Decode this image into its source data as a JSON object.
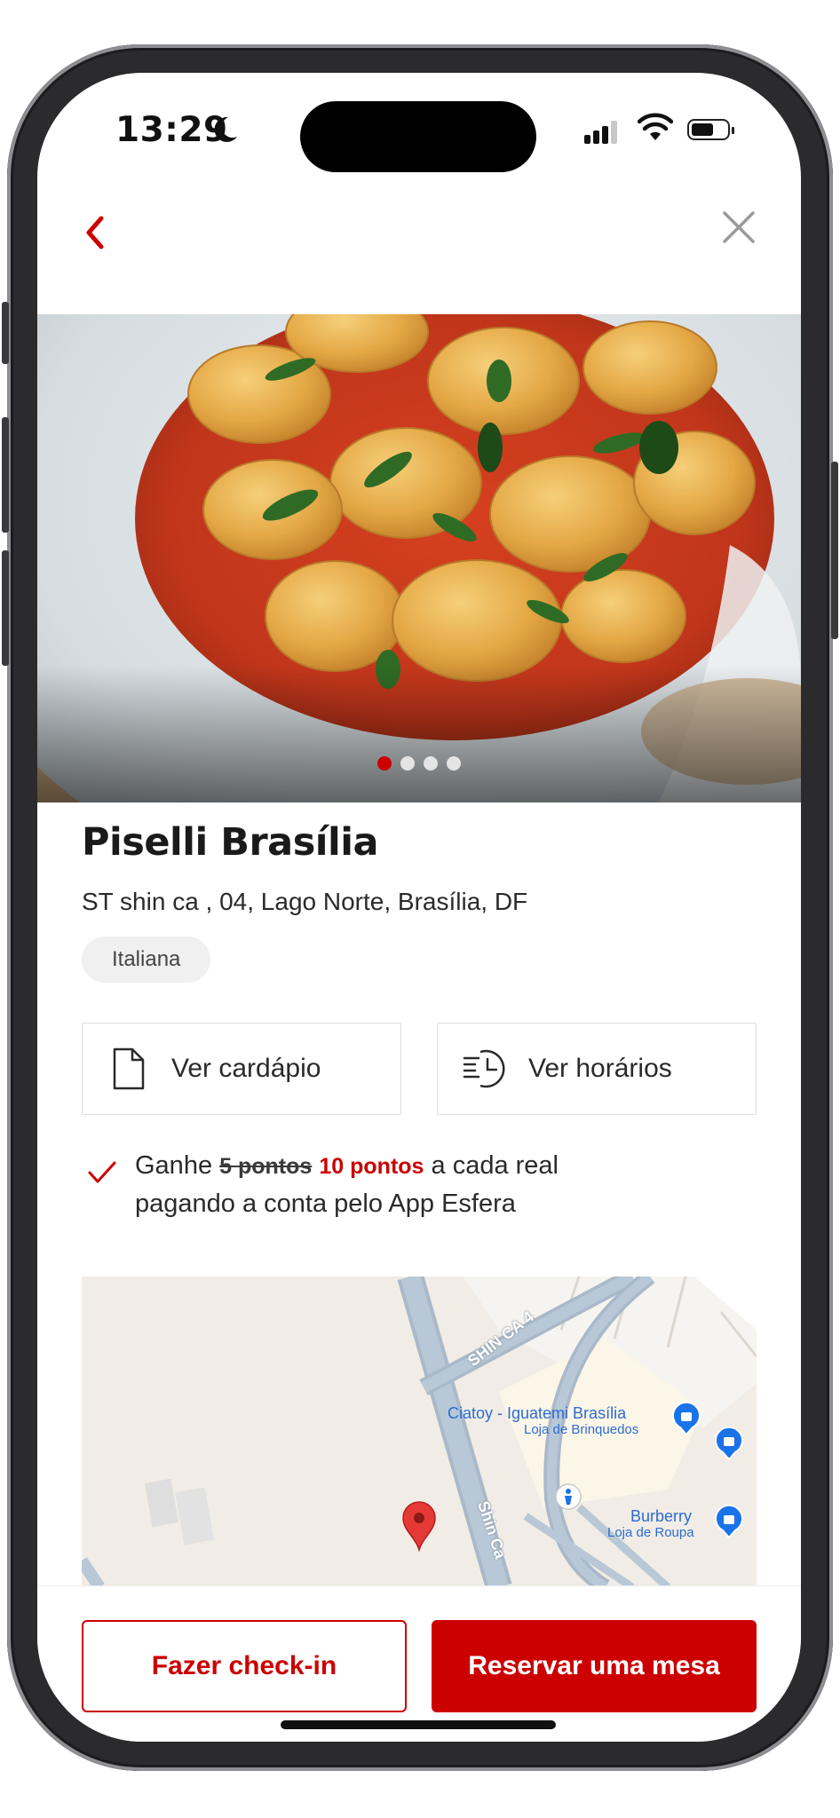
{
  "status_bar": {
    "time": "13:29",
    "icons": [
      "moon-icon",
      "cellular-signal-icon",
      "wifi-icon",
      "battery-icon"
    ]
  },
  "nav": {
    "back_icon": "chevron-left-icon",
    "close_icon": "close-icon"
  },
  "gallery": {
    "image": "plate of tortellini with tomato sauce and basil",
    "total_slides": 4,
    "active_slide": 1
  },
  "restaurant": {
    "name": "Piselli Brasília",
    "address": "ST shin ca , 04, Lago Norte, Brasília, DF",
    "cuisine_tag": "Italiana"
  },
  "actions": {
    "menu_label": "Ver cardápio",
    "menu_icon": "document-icon",
    "hours_label": "Ver horários",
    "hours_icon": "clock-list-icon"
  },
  "points": {
    "prefix": "Ganhe",
    "old_points": "5 pontos",
    "new_points": "10 pontos",
    "suffix": "a cada real",
    "line2": "pagando a conta pelo App Esfera"
  },
  "map": {
    "road_1": "SHIN CA 4",
    "road_2": "Shin Ca",
    "poi_1_name": "Ciatoy - Iguatemi Brasília",
    "poi_1_category": "Loja de Brinquedos",
    "poi_2_name": "Burberry",
    "poi_2_category": "Loja de Roupa",
    "marker": "map-pin-icon"
  },
  "footer": {
    "checkin_label": "Fazer check-in",
    "reserve_label": "Reservar uma mesa"
  },
  "colors": {
    "accent": "#cc0000",
    "text": "#2a2a2a",
    "tag_bg": "#f0f0f0"
  }
}
